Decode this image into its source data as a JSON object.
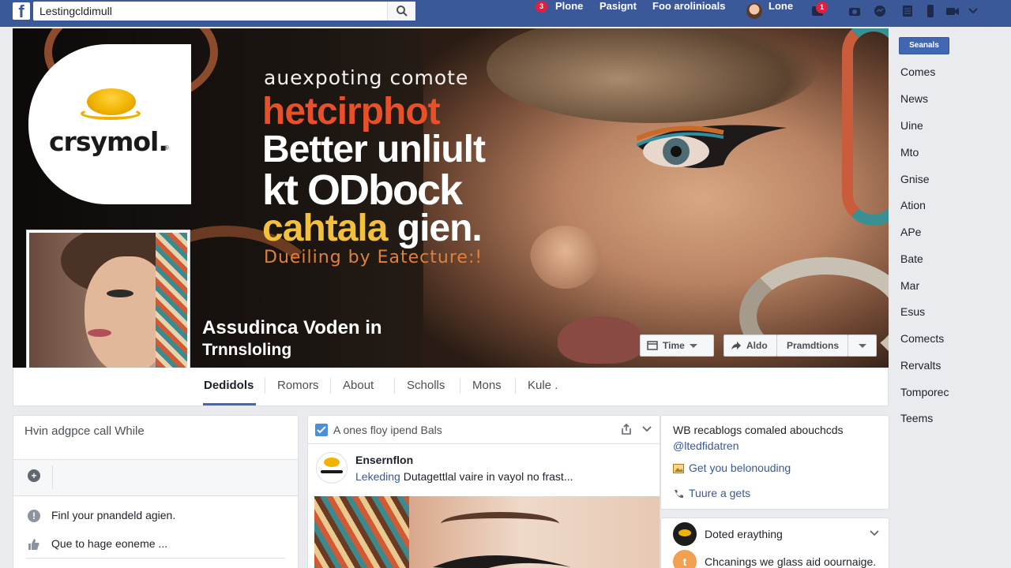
{
  "topbar": {
    "search_value": "Lestingcldimull",
    "nav_items": [
      "Plone",
      "Pasignt",
      "Foo arolinioals",
      "Lone"
    ],
    "badges": [
      "3",
      "1"
    ]
  },
  "cover": {
    "logo_text": "crsymol.",
    "logo_tm": "®",
    "headline_1": "auexpoting comote",
    "headline_2": "hetcirphot",
    "headline_3": "Better unliult",
    "headline_4": "kt ODbock",
    "headline_5_a": "cahtala",
    "headline_5_b": " gien.",
    "headline_6": "Dueiling by Eatecture:!",
    "page_name": "Assudinca Voden in",
    "page_category": "Trnnsloling",
    "buttons": {
      "time": "Time",
      "aldo": "Aldo",
      "pramdtions": "Pramdtions"
    }
  },
  "tabs": [
    "Dedidols",
    "Romors",
    "About",
    "Scholls",
    "Mons",
    "Kule ."
  ],
  "right_sidebar": {
    "button": "Seanals",
    "items": [
      "Comes",
      "News",
      "Uine",
      "Mto",
      "Gnise",
      "Ation",
      "APe",
      "Bate",
      "Mar",
      "Esus",
      "Comects",
      "Rervalts",
      "Tomporec",
      "Teems"
    ]
  },
  "left_card": {
    "title": "Hvin adgpce call While",
    "rows": [
      "Finl your pnandeld agien.",
      "Que to hage eoneme ..."
    ]
  },
  "middle_card": {
    "title": "A ones floy ipend Bals",
    "author": "Ensernflon",
    "meta_link": "Lekeding",
    "meta_text": " Dutagettlal vaire in vayol no frast..."
  },
  "right_card": {
    "title": "WB recablogs comaled abouchcds",
    "handle": "@ltedfidatren",
    "link_1": "Get you belonouding",
    "link_2": "Tuure a gets",
    "item_1": "Doted eraything",
    "item_2": "Chcanings we glass aid oournaige."
  },
  "colors": {
    "brand": "#3b5998",
    "accent": "#4267b2",
    "headline_orange": "#e8502a",
    "headline_yellow": "#f2c03c"
  }
}
